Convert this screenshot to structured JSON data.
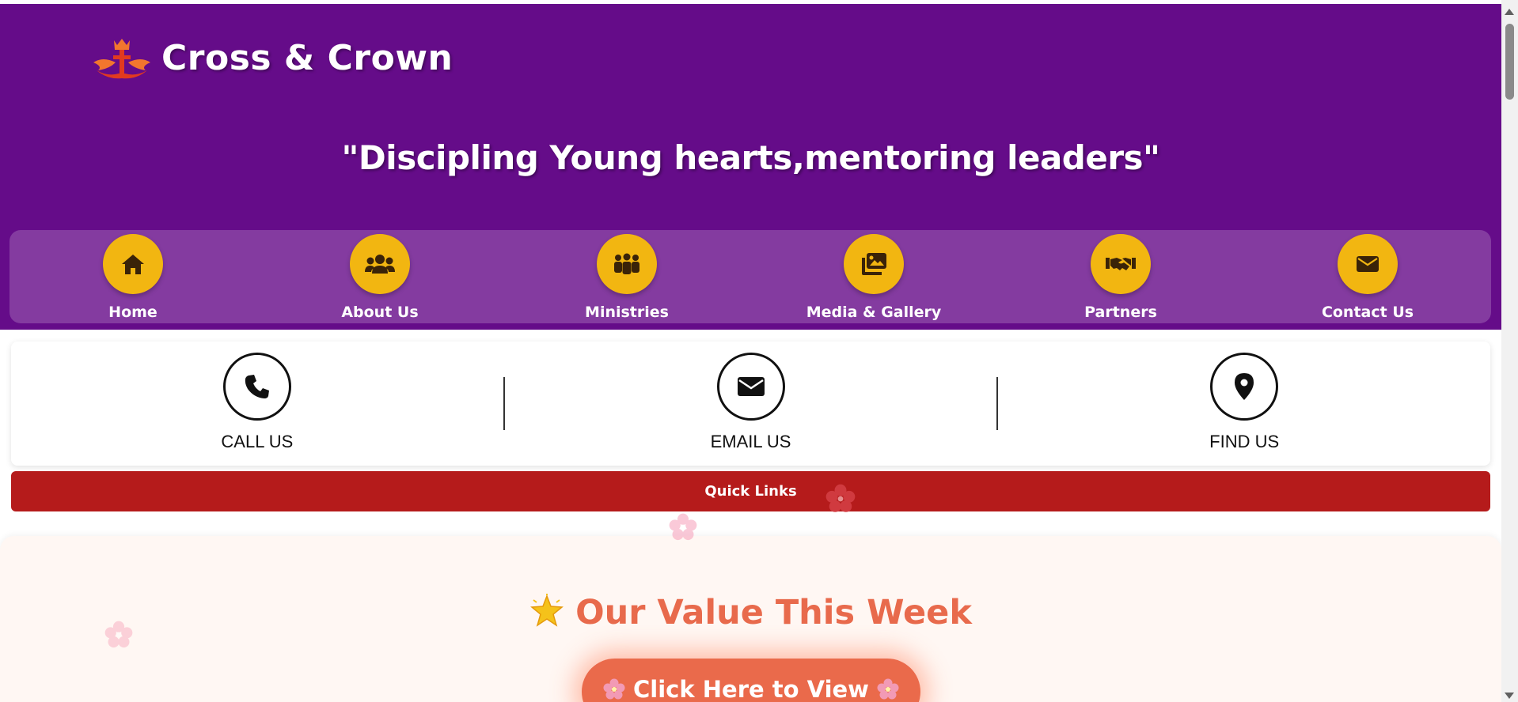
{
  "brand": {
    "name": "Cross & Crown"
  },
  "header": {
    "tagline": "\"Discipling Young hearts,mentoring leaders\""
  },
  "nav": {
    "items": [
      {
        "label": "Home",
        "icon": "home-icon"
      },
      {
        "label": "About Us",
        "icon": "users-icon"
      },
      {
        "label": "Ministries",
        "icon": "people-group-icon"
      },
      {
        "label": "Media & Gallery",
        "icon": "photo-gallery-icon"
      },
      {
        "label": "Partners",
        "icon": "handshake-icon"
      },
      {
        "label": "Contact Us",
        "icon": "envelope-icon"
      }
    ]
  },
  "contact": {
    "items": [
      {
        "label": "CALL US",
        "icon": "phone-icon"
      },
      {
        "label": "EMAIL US",
        "icon": "envelope-icon"
      },
      {
        "label": "FIND US",
        "icon": "location-pin-icon"
      }
    ]
  },
  "quick_links": {
    "label": "Quick Links"
  },
  "value_section": {
    "title": "Our Value This Week",
    "button_label": "Click Here to View"
  },
  "colors": {
    "header_bg": "#650c89",
    "nav_bg": "#843ba0",
    "nav_circle": "#f2b611",
    "quick_links_bg": "#b51b1b",
    "accent": "#e86a4c"
  }
}
